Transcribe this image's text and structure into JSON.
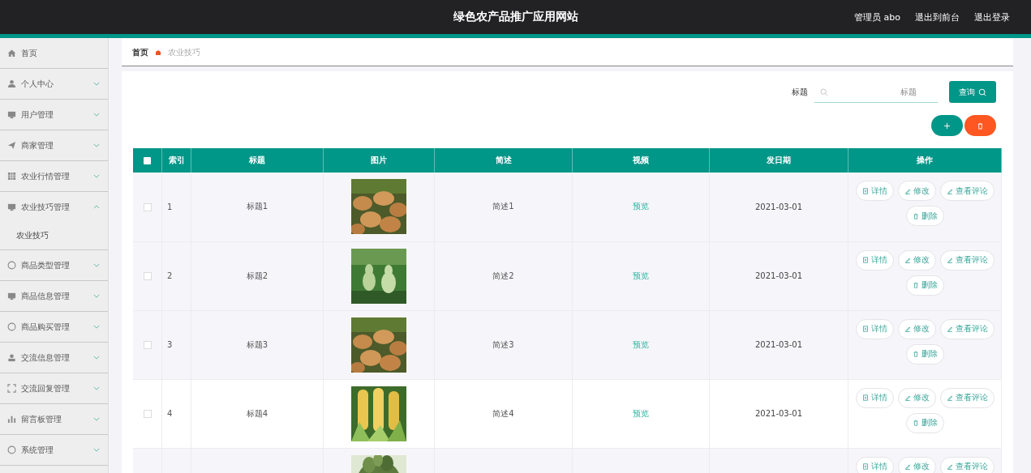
{
  "header": {
    "title": "绿色农产品推广应用网站",
    "user": "管理员 abo",
    "links": [
      "退出到前台",
      "退出登录"
    ]
  },
  "sidebar": {
    "items": [
      {
        "label": "首页"
      },
      {
        "label": "个人中心",
        "expanded": false
      },
      {
        "label": "用户管理",
        "expanded": false
      },
      {
        "label": "商家管理",
        "expanded": false
      },
      {
        "label": "农业行情管理",
        "expanded": false
      },
      {
        "label": "农业技巧管理",
        "expanded": true,
        "children": [
          {
            "label": "农业技巧"
          }
        ]
      },
      {
        "label": "商品类型管理",
        "expanded": false
      },
      {
        "label": "商品信息管理",
        "expanded": false
      },
      {
        "label": "商品购买管理",
        "expanded": false
      },
      {
        "label": "交流信息管理",
        "expanded": false
      },
      {
        "label": "交流回复管理",
        "expanded": false
      },
      {
        "label": "留言板管理",
        "expanded": false
      },
      {
        "label": "系统管理",
        "expanded": false
      }
    ]
  },
  "breadcrumb": [
    "首页",
    "农业技巧"
  ],
  "search": {
    "label": "标题",
    "placeholder": "标题",
    "button": "查询"
  },
  "table": {
    "select_all_checked": false,
    "columns": [
      "索引",
      "标题",
      "图片",
      "简述",
      "视频",
      "发日期",
      "操作"
    ],
    "rows": [
      {
        "checked": false,
        "index": "1",
        "title": "标题1",
        "summary": "简述1",
        "video": "预览",
        "date": "2021-03-01",
        "buttons": [
          "详情",
          "修改",
          "查看评论",
          "删除"
        ]
      },
      {
        "checked": false,
        "index": "2",
        "title": "标题2",
        "summary": "简述2",
        "video": "预览",
        "date": "2021-03-01",
        "buttons": [
          "详情",
          "修改",
          "查看评论",
          "删除"
        ]
      },
      {
        "checked": false,
        "index": "3",
        "title": "标题3",
        "summary": "简述3",
        "video": "预览",
        "date": "2021-03-01",
        "buttons": [
          "详情",
          "修改",
          "查看评论",
          "删除"
        ]
      },
      {
        "checked": false,
        "index": "4",
        "title": "标题4",
        "summary": "简述4",
        "video": "预览",
        "date": "2021-03-01",
        "buttons": [
          "详情",
          "修改",
          "查看评论",
          "删除"
        ]
      },
      {
        "buttons": [
          "详情",
          "修改",
          "查看评论"
        ]
      }
    ]
  }
}
